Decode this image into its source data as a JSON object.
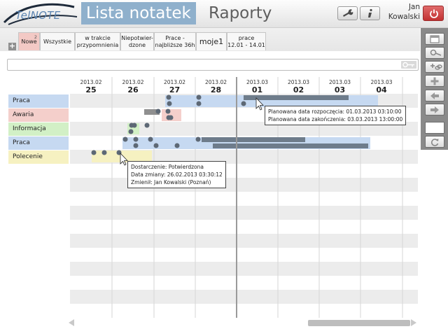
{
  "header": {
    "logo_text": "TelNOTE",
    "title_active": "Lista notatek",
    "title_second": "Raporty",
    "user": {
      "first": "Jan",
      "last": "Kowalski"
    },
    "icons": [
      "wrench-icon",
      "info-icon",
      "power-icon"
    ]
  },
  "tabs": {
    "add_label": "+",
    "items": [
      {
        "label": "Nowe",
        "count": "2"
      },
      {
        "label": "Wszystkie"
      },
      {
        "label_line1": "w trakcie",
        "label_line2": "przypomnienia"
      },
      {
        "label_line1": "Niepotwier-",
        "label_line2": "dzone"
      },
      {
        "label_line1": "Prace -",
        "label_line2": "najbliższe 36h"
      },
      {
        "label": "moje1"
      },
      {
        "label_line1": "prace",
        "label_line2": "12.01 - 14.01"
      }
    ]
  },
  "search": {
    "value": "",
    "placeholder": ""
  },
  "right_toolbar": {
    "icons": [
      "calendar-icon",
      "key-icon",
      "add-link-icon",
      "plus-icon",
      "arrow-left-icon",
      "arrow-right-icon",
      "blank-field",
      "refresh-icon"
    ]
  },
  "timeline": {
    "days": [
      {
        "month": "2013.02",
        "day": "25"
      },
      {
        "month": "2013.02",
        "day": "26"
      },
      {
        "month": "2013.02",
        "day": "27"
      },
      {
        "month": "2013.02",
        "day": "28"
      },
      {
        "month": "2013.03",
        "day": "01"
      },
      {
        "month": "2013.03",
        "day": "02"
      },
      {
        "month": "2013.03",
        "day": "03"
      },
      {
        "month": "2013.03",
        "day": "04"
      }
    ],
    "rows": [
      {
        "label": "Praca",
        "color": "#c6d9f1"
      },
      {
        "label": "Awaria",
        "color": "#f4cfcb"
      },
      {
        "label": "Informacja",
        "color": "#d2f0c6"
      },
      {
        "label": "Praca",
        "color": "#c6d9f1"
      },
      {
        "label": "Polecenie",
        "color": "#f6f1c1"
      }
    ]
  },
  "tooltip_top": {
    "line1": "Planowana data rozpoczęcia: 01.03.2013 03:10:00",
    "line2": "Planowana data zakończenia: 03.03.2013 13:00:00"
  },
  "tooltip_bottom": {
    "line1": "Dostarczenie: Potwierdzona",
    "line2": "Data zmiany: 26.02.2013 03:30:12",
    "line3": "Zmienił: Jan Kowalski (Poznań)"
  }
}
